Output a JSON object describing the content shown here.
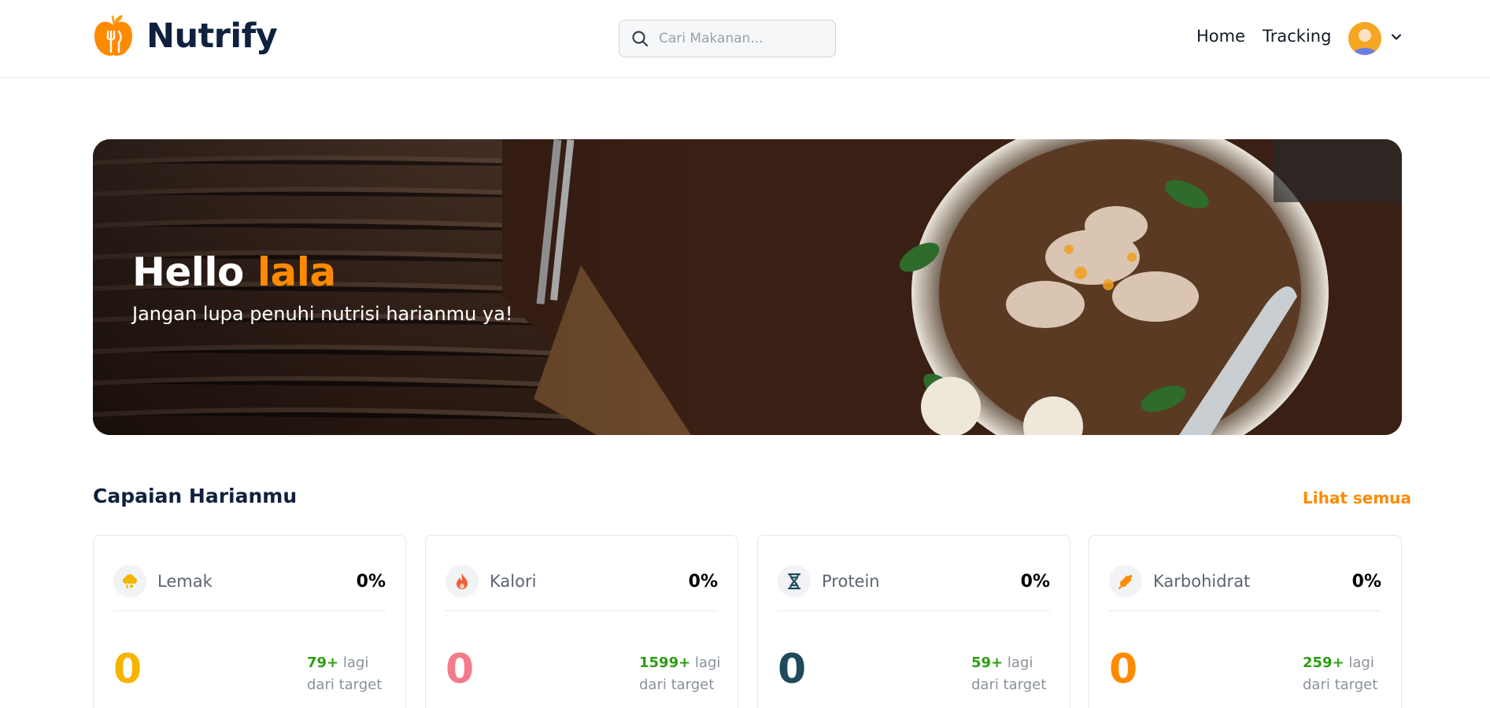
{
  "app": {
    "brand": "Nutrify"
  },
  "search": {
    "placeholder": "Cari Makanan..."
  },
  "nav": {
    "home": "Home",
    "tracking": "Tracking"
  },
  "hero": {
    "greeting": "Hello",
    "username": "lala",
    "subtitle": "Jangan lupa penuhi nutrisi harianmu ya!"
  },
  "section": {
    "title": "Capaian Harianmu",
    "see_all": "Lihat semua"
  },
  "cards": [
    {
      "label": "Lemak",
      "percent": "0%",
      "value": "0",
      "remaining": "79+",
      "remaining_text": "lagi",
      "target_text": "dari target",
      "icon": "fat-icon",
      "color": "#f5b400"
    },
    {
      "label": "Kalori",
      "percent": "0%",
      "value": "0",
      "remaining": "1599+",
      "remaining_text": "lagi",
      "target_text": "dari target",
      "icon": "fire-icon",
      "color": "#f47c8a"
    },
    {
      "label": "Protein",
      "percent": "0%",
      "value": "0",
      "remaining": "59+",
      "remaining_text": "lagi",
      "target_text": "dari target",
      "icon": "dna-icon",
      "color": "#1f4a5c"
    },
    {
      "label": "Karbohidrat",
      "percent": "0%",
      "value": "0",
      "remaining": "259+",
      "remaining_text": "lagi",
      "target_text": "dari target",
      "icon": "wheat-icon",
      "color": "#ff8a00"
    }
  ],
  "colors": {
    "accent": "#ff8a00",
    "brand_dark": "#10213f",
    "success": "#2e9e12"
  }
}
